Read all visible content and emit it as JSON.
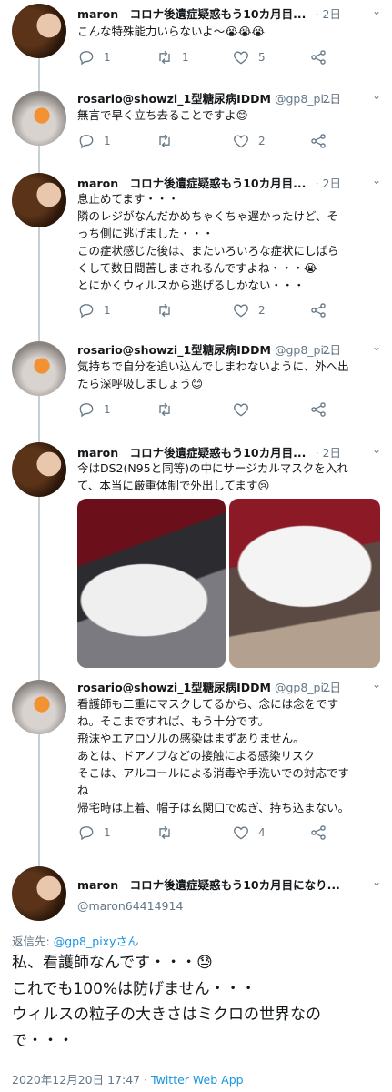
{
  "tweets": [
    {
      "name": "maron　コロナ後遺症疑惑もう10カ月目...",
      "handle": "",
      "date": "· 2日",
      "lines": [
        "こんな特殊能力いらないよ〜😭😭😭"
      ],
      "reply_count": "1",
      "retweet_count": "1",
      "like_count": "5"
    },
    {
      "name": "rosario@showzi_1型糖尿病IDDM",
      "handle": "@gp8_pi...",
      "date": "· 2日",
      "lines": [
        "無言で早く立ち去ることですよ😊"
      ],
      "reply_count": "1",
      "retweet_count": "",
      "like_count": "2"
    },
    {
      "name": "maron　コロナ後遺症疑惑もう10カ月目...",
      "handle": "",
      "date": "· 2日",
      "lines": [
        "息止めてます・・・",
        "隣のレジがなんだかめちゃくちゃ遅かったけど、そ",
        "っち側に逃げました・・・",
        "この症状感じた後は、またいろいろな症状にしばら",
        "くして数日間苦しまされるんですよね・・・😭",
        "とにかくウィルスから逃げるしかない・・・"
      ],
      "reply_count": "1",
      "retweet_count": "",
      "like_count": "2"
    },
    {
      "name": "rosario@showzi_1型糖尿病IDDM",
      "handle": "@gp8_pi...",
      "date": "· 2日",
      "lines": [
        "気持ちで自分を追い込んでしまわないように、外へ出",
        "たら深呼吸しましょう😊"
      ],
      "reply_count": "1",
      "retweet_count": "",
      "like_count": ""
    },
    {
      "name": "maron　コロナ後遺症疑惑もう10カ月目...",
      "handle": "",
      "date": "· 2日",
      "lines": [
        "今はDS2(N95と同等)の中にサージカルマスクを入れ",
        "て、本当に厳重体制で外出してます😢"
      ],
      "reply_count": "",
      "retweet_count": "",
      "like_count": ""
    },
    {
      "name": "rosario@showzi_1型糖尿病IDDM",
      "handle": "@gp8_pi...",
      "date": "· 2日",
      "lines": [
        "看護師も二重にマスクしてるから、念には念をです",
        "ね。そこまですれば、もう十分です。",
        "飛沫やエアロゾルの感染はまずありません。",
        "あとは、ドアノブなどの接触による感染リスク",
        "そこは、アルコールによる消毒や手洗いでの対応です",
        "ね",
        "帰宅時は上着、帽子は玄関口でぬぎ、持ち込まない。"
      ],
      "reply_count": "1",
      "retweet_count": "",
      "like_count": "4"
    }
  ],
  "main": {
    "name": "maron　コロナ後遺症疑惑もう10カ月目になり...",
    "handle": "@maron64414914",
    "reply_prefix": "返信先: ",
    "reply_to": "@gp8_pixyさん",
    "lines": [
      "私、看護師なんです・・・😓",
      "これでも100%は防げません・・・",
      "ウィルスの粒子の大きさはミクロの世界なの",
      "で・・・"
    ],
    "timestamp": "2020年12月20日 17:47 · ",
    "app": "Twitter Web App"
  },
  "icons": {
    "caret": "chevron-down-icon",
    "reply": "reply-icon",
    "retweet": "retweet-icon",
    "like": "heart-icon",
    "share": "share-icon"
  },
  "colors": {
    "link": "#1b95e0",
    "muted": "#657786",
    "text": "#14171a"
  }
}
